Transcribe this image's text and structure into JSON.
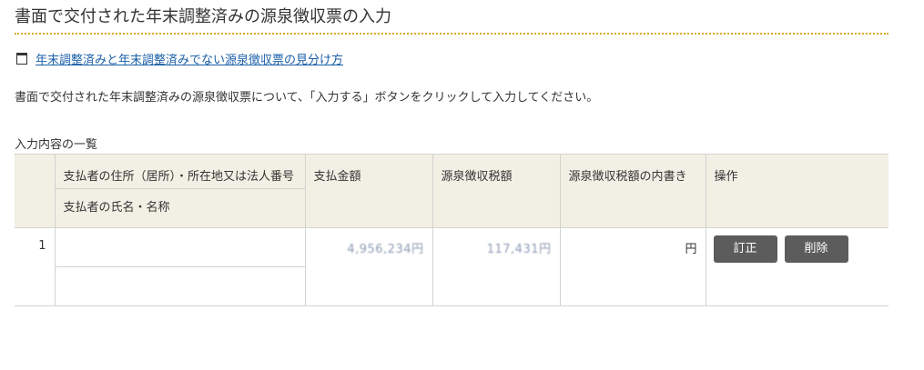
{
  "page": {
    "title": "書面で交付された年末調整済みの源泉徴収票の入力",
    "help_link": "年末調整済みと年末調整済みでない源泉徴収票の見分け方",
    "instruction": "書面で交付された年末調整済みの源泉徴収票について、「入力する」ボタンをクリックして入力してください。",
    "list_caption": "入力内容の一覧"
  },
  "table": {
    "headers": {
      "payer_address": "支払者の住所（居所）・所在地又は法人番号",
      "payer_name": "支払者の氏名・名称",
      "payment_amount": "支払金額",
      "withholding_tax": "源泉徴収税額",
      "withholding_tax_breakdown": "源泉徴収税額の内書き",
      "operation": "操作"
    },
    "rows": [
      {
        "index": "1",
        "payer_address": "",
        "payer_name": "",
        "payment_amount": "4,956,234円",
        "withholding_tax": "117,431円",
        "withholding_tax_breakdown": "円",
        "edit_label": "訂正",
        "delete_label": "削除"
      }
    ]
  },
  "colors": {
    "title_underline": "#d9a826",
    "link": "#1a5fa8",
    "header_bg": "#f2efe4",
    "button_bg": "#5c5c5c"
  },
  "icons": {
    "help_link_icon": "new-window-icon"
  }
}
